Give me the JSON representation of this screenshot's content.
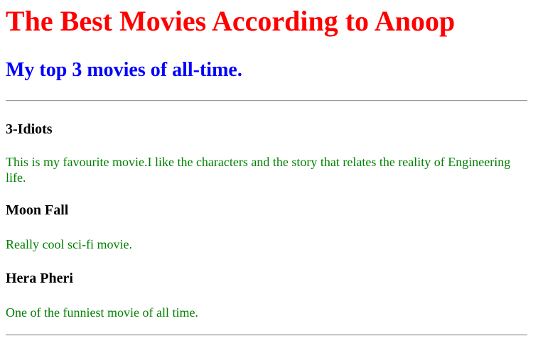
{
  "header": {
    "title": "The Best Movies According to Anoop",
    "subtitle": "My top 3 movies of all-time."
  },
  "movies": [
    {
      "title": "3-Idiots",
      "description": "This is my favourite movie.I like the characters and the story that relates the reality of Engineering life."
    },
    {
      "title": "Moon Fall",
      "description": "Really cool sci-fi movie."
    },
    {
      "title": "Hera Pheri",
      "description": "One of the funniest movie of all time."
    }
  ],
  "colors": {
    "title": "#ff0000",
    "subtitle": "#0000ff",
    "description": "#008000",
    "movie_title": "#000000"
  }
}
